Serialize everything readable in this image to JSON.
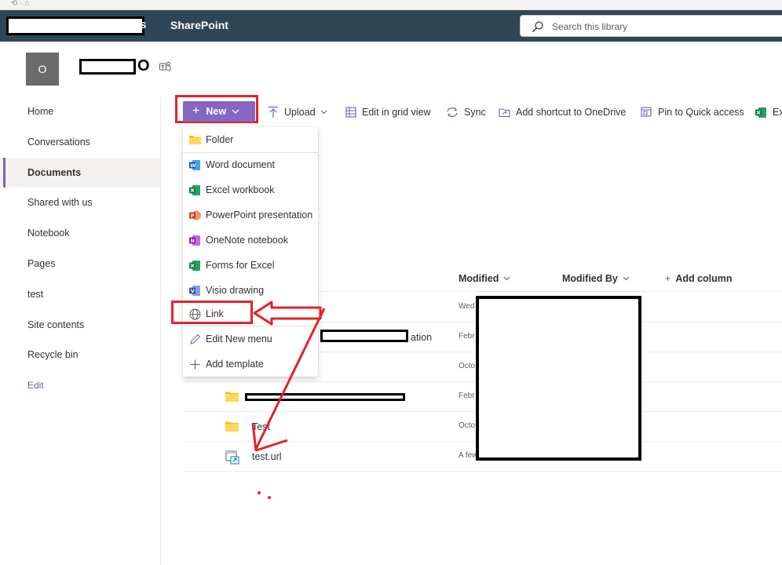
{
  "app": {
    "suite_name": "SharePoint",
    "suite_trail": "s",
    "search_placeholder": "Search this library"
  },
  "site": {
    "logo_letter": "O",
    "name_trail": "O"
  },
  "nav": {
    "items": [
      {
        "label": "Home"
      },
      {
        "label": "Conversations"
      },
      {
        "label": "Documents",
        "active": true
      },
      {
        "label": "Shared with us"
      },
      {
        "label": "Notebook"
      },
      {
        "label": "Pages"
      },
      {
        "label": "test"
      },
      {
        "label": "Site contents"
      },
      {
        "label": "Recycle bin"
      }
    ],
    "edit_label": "Edit"
  },
  "toolbar": {
    "new_label": "New",
    "upload_label": "Upload",
    "grid_label": "Edit in grid view",
    "sync_label": "Sync",
    "shortcut_label": "Add shortcut to OneDrive",
    "pin_label": "Pin to Quick access",
    "export_label": "Ex"
  },
  "new_menu": {
    "items": [
      {
        "label": "Folder",
        "icon": "folder-icon"
      },
      {
        "label": "Word document",
        "icon": "word-icon"
      },
      {
        "label": "Excel workbook",
        "icon": "excel-icon"
      },
      {
        "label": "PowerPoint presentation",
        "icon": "powerpoint-icon"
      },
      {
        "label": "OneNote notebook",
        "icon": "onenote-icon"
      },
      {
        "label": "Forms for Excel",
        "icon": "forms-excel-icon"
      },
      {
        "label": "Visio drawing",
        "icon": "visio-icon"
      },
      {
        "label": "Link",
        "icon": "globe-icon"
      },
      {
        "label": "Edit New menu",
        "icon": "pencil-icon"
      },
      {
        "label": "Add template",
        "icon": "plus-icon"
      }
    ]
  },
  "list": {
    "columns": {
      "modified": "Modified",
      "modified_by": "Modified By",
      "add_column": "Add column"
    },
    "rows": [
      {
        "name": "",
        "modified": "Wed"
      },
      {
        "name": "ation",
        "modified": "Febr"
      },
      {
        "name": "",
        "modified": "Octo"
      },
      {
        "name": "",
        "modified": "Febr"
      },
      {
        "name": "Test",
        "modified": "Octo"
      },
      {
        "name": "test.url",
        "modified": "A few"
      }
    ]
  },
  "colors": {
    "suite_bar": "#2f4656",
    "accent": "#8666c3",
    "annotation_red": "#e1242a"
  }
}
